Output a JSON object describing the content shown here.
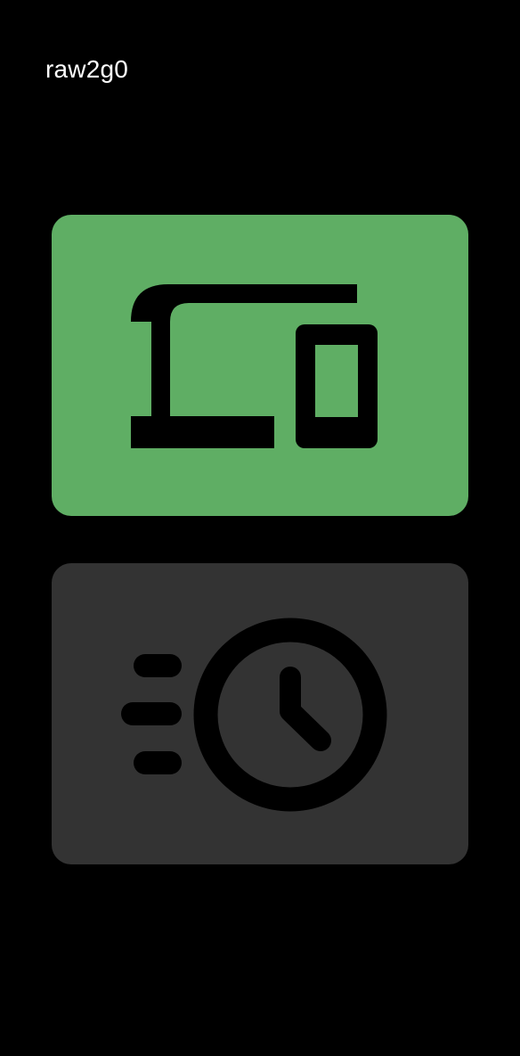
{
  "header": {
    "title": "raw2g0"
  },
  "tiles": [
    {
      "icon": "devices-icon",
      "color": "#5FAE64",
      "selected": true
    },
    {
      "icon": "history-clock-icon",
      "color": "#333333",
      "selected": false
    }
  ],
  "colors": {
    "background": "#000000",
    "text": "#FFFFFF",
    "icon": "#000000"
  }
}
